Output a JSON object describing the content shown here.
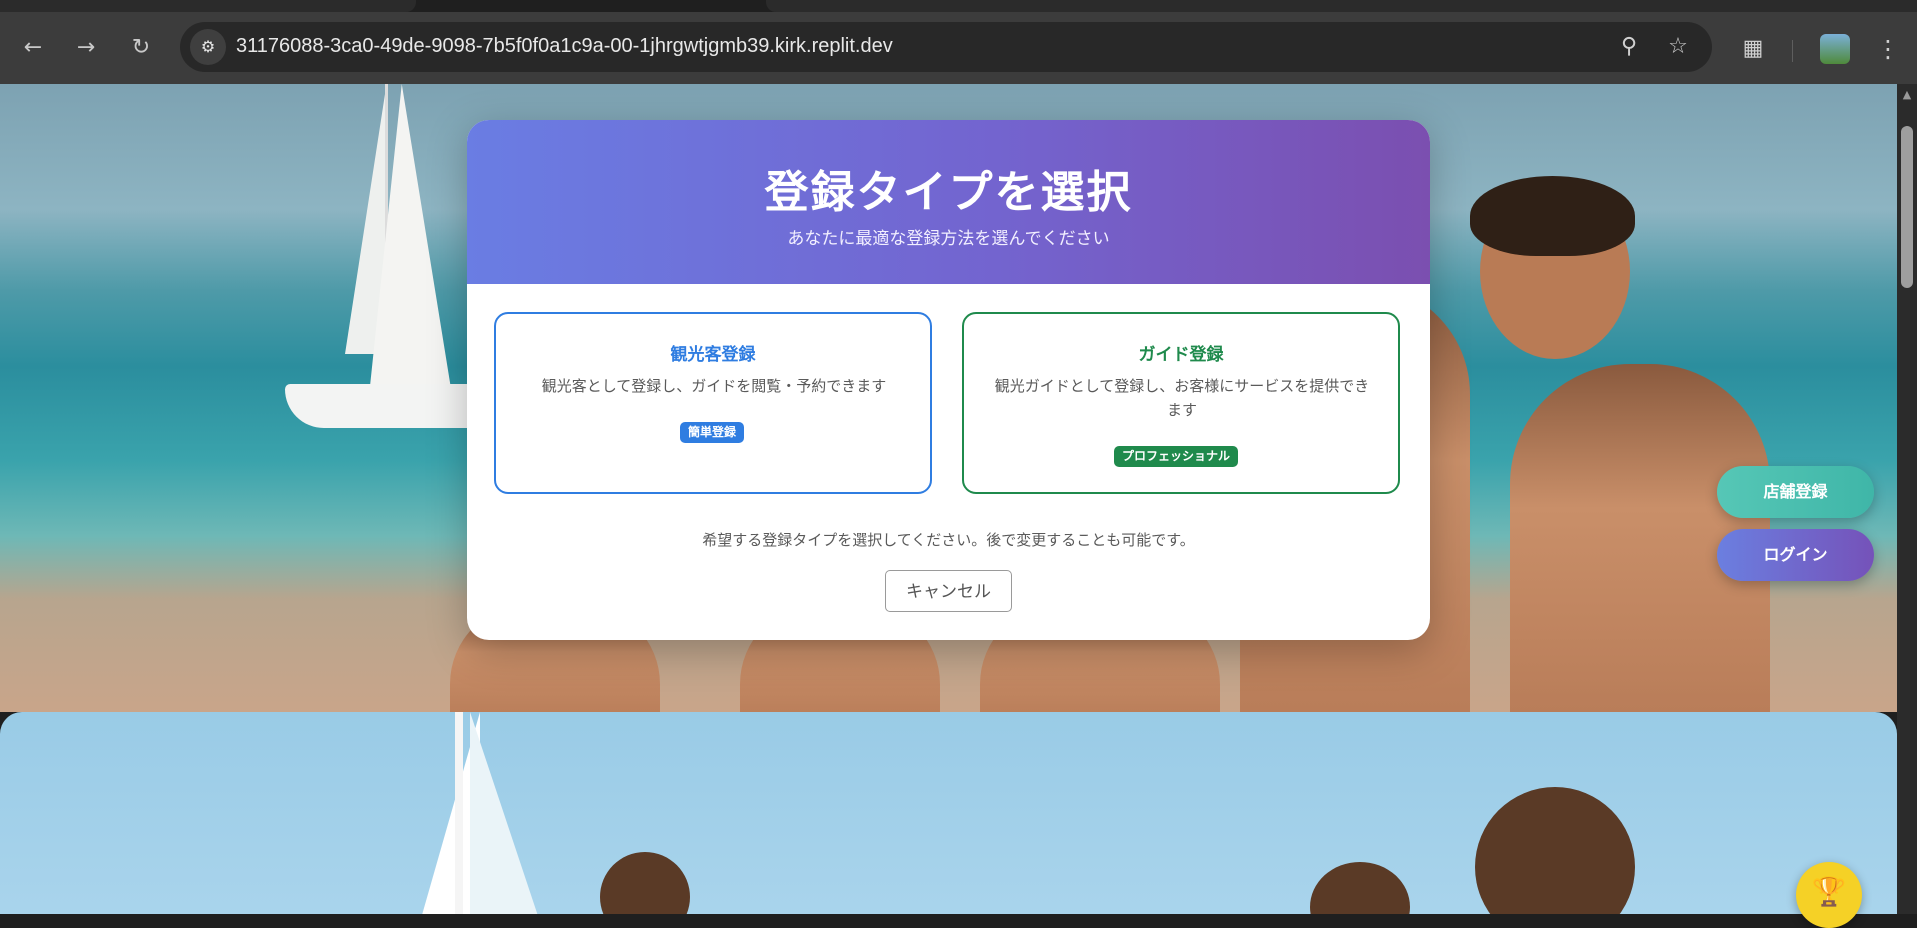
{
  "browser": {
    "url": "31176088-3ca0-49de-9098-7b5f0f0a1c9a-00-1jhrgwtjgmb39.kirk.replit.dev",
    "icons": {
      "back": "arrow-left-icon",
      "forward": "arrow-right-icon",
      "reload": "reload-icon",
      "site_info": "tune-icon",
      "zoom": "magnifier-icon",
      "bookmark": "star-icon",
      "extensions": "puzzle-icon",
      "menu": "kebab-menu-icon"
    }
  },
  "modal": {
    "title": "登録タイプを選択",
    "subtitle": "あなたに最適な登録方法を選んでください",
    "options": [
      {
        "title": "観光客登録",
        "description": "観光客として登録し、ガイドを閲覧・予約できます",
        "badge": "簡単登録",
        "color": "#2f7de1"
      },
      {
        "title": "ガイド登録",
        "description": "観光ガイドとして登録し、お客様にサービスを提供できます",
        "badge": "プロフェッショナル",
        "color": "#1f8a4c"
      }
    ],
    "hint": "希望する登録タイプを選択してください。後で変更することも可能です。",
    "cancel_label": "キャンセル"
  },
  "floating": {
    "store_label": "店舗登録",
    "login_label": "ログイン",
    "trophy_icon": "trophy-icon"
  },
  "colors": {
    "header_start": "#6a7de3",
    "header_end": "#7b4fb0",
    "store_button": "#4fc2b2",
    "login_button": "#6f6ad0",
    "trophy": "#f5d126"
  }
}
